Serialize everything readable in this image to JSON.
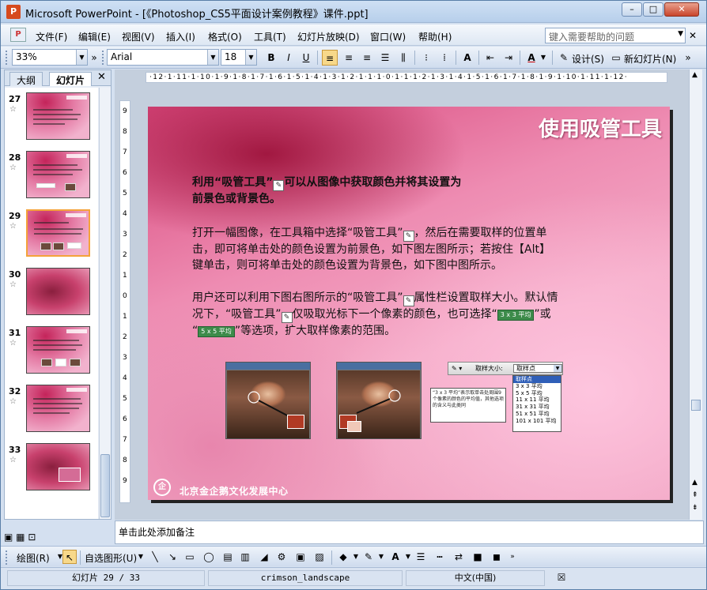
{
  "window": {
    "title": "Microsoft PowerPoint - [《Photoshop_CS5平面设计案例教程》课件.ppt]",
    "min_label": "–",
    "max_label": "□",
    "close_label": "✕"
  },
  "menu": {
    "items": [
      "文件(F)",
      "编辑(E)",
      "视图(V)",
      "插入(I)",
      "格式(O)",
      "工具(T)",
      "幻灯片放映(D)",
      "窗口(W)",
      "帮助(H)"
    ],
    "help_placeholder": "键入需要帮助的问题",
    "close_label": "✕"
  },
  "toolbar": {
    "zoom": "33%",
    "font": "Arial",
    "font_size": "18",
    "bold": "B",
    "italic": "I",
    "underline": "U",
    "design_label": "设计(S)",
    "new_slide_label": "新幻灯片(N)"
  },
  "left_panel": {
    "tabs": [
      "大纲",
      "幻灯片"
    ],
    "close_label": "✕",
    "slides": [
      {
        "num": "27",
        "star": "☆"
      },
      {
        "num": "28",
        "star": "☆"
      },
      {
        "num": "29",
        "star": "☆"
      },
      {
        "num": "30",
        "star": "☆"
      },
      {
        "num": "31",
        "star": "☆"
      },
      {
        "num": "32",
        "star": "☆"
      },
      {
        "num": "33",
        "star": "☆"
      }
    ]
  },
  "ruler": {
    "horizontal": "·12·1·11·1·10·1·9·1·8·1·7·1·6·1·5·1·4·1·3·1·2·1·1·1·0·1·1·1·2·1·3·1·4·1·5·1·6·1·7·1·8·1·9·1·10·1·11·1·12·",
    "vertical": [
      "9",
      "8",
      "7",
      "6",
      "5",
      "4",
      "3",
      "2",
      "1",
      "0",
      "1",
      "2",
      "3",
      "4",
      "5",
      "6",
      "7",
      "8",
      "9"
    ]
  },
  "slide": {
    "title": "使用吸管工具",
    "para1_a": "利用“吸管工具”",
    "para1_b": "可以从图像中获取颜色并将其设置为",
    "para1_c": "前景色或背景色。",
    "para2_a": "打开一幅图像，在工具箱中选择“吸管工具”",
    "para2_b": "，然后在需要取样的位置单",
    "para2_c": "击，即可将单击处的颜色设置为前景色，如下图左图所示；若按住【Alt】",
    "para2_d": "键单击，则可将单击处的颜色设置为背景色，如下图中图所示。",
    "para3_a": "用户还可以利用下图右图所示的“吸管工具”",
    "para3_b": "属性栏设置取样大小。默认情",
    "para3_c": "况下，“吸管工具”",
    "para3_d": "仅吸取光标下一个像素的颜色，也可选择“",
    "para3_tag1": "3 x 3 平均",
    "para3_e": "”或",
    "para3_f": "“",
    "para3_tag2": "5 x 5 平均",
    "para3_g": "”等选项，扩大取样像素的范围。",
    "eyedropper_label": "取样大小:",
    "eyedropper_value": "取样点",
    "eyedropper_options": [
      "取样点",
      "3 x 3 平均",
      "5 x 5 平均",
      "11 x 11 平均",
      "31 x 31 平均",
      "51 x 51 平均",
      "101 x 101 平均"
    ],
    "callout": "“3 x 3 平均”表示取单击处周围9个像素的颜色的平均值，其他选项的含义与此类同",
    "footer": "北京金企鹅文化发展中心"
  },
  "notes": {
    "placeholder": "单击此处添加备注"
  },
  "drawbar": {
    "draw_label": "绘图(R)",
    "autoshape_label": "自选图形(U)"
  },
  "status": {
    "slide_info": "幻灯片 29 / 33",
    "design": "crimson_landscape",
    "language": "中文(中国)"
  },
  "colors": {
    "accent_selected": "#f4a23a",
    "slide_pink": "#ee8cb2",
    "slide_crimson": "#c4245a"
  }
}
